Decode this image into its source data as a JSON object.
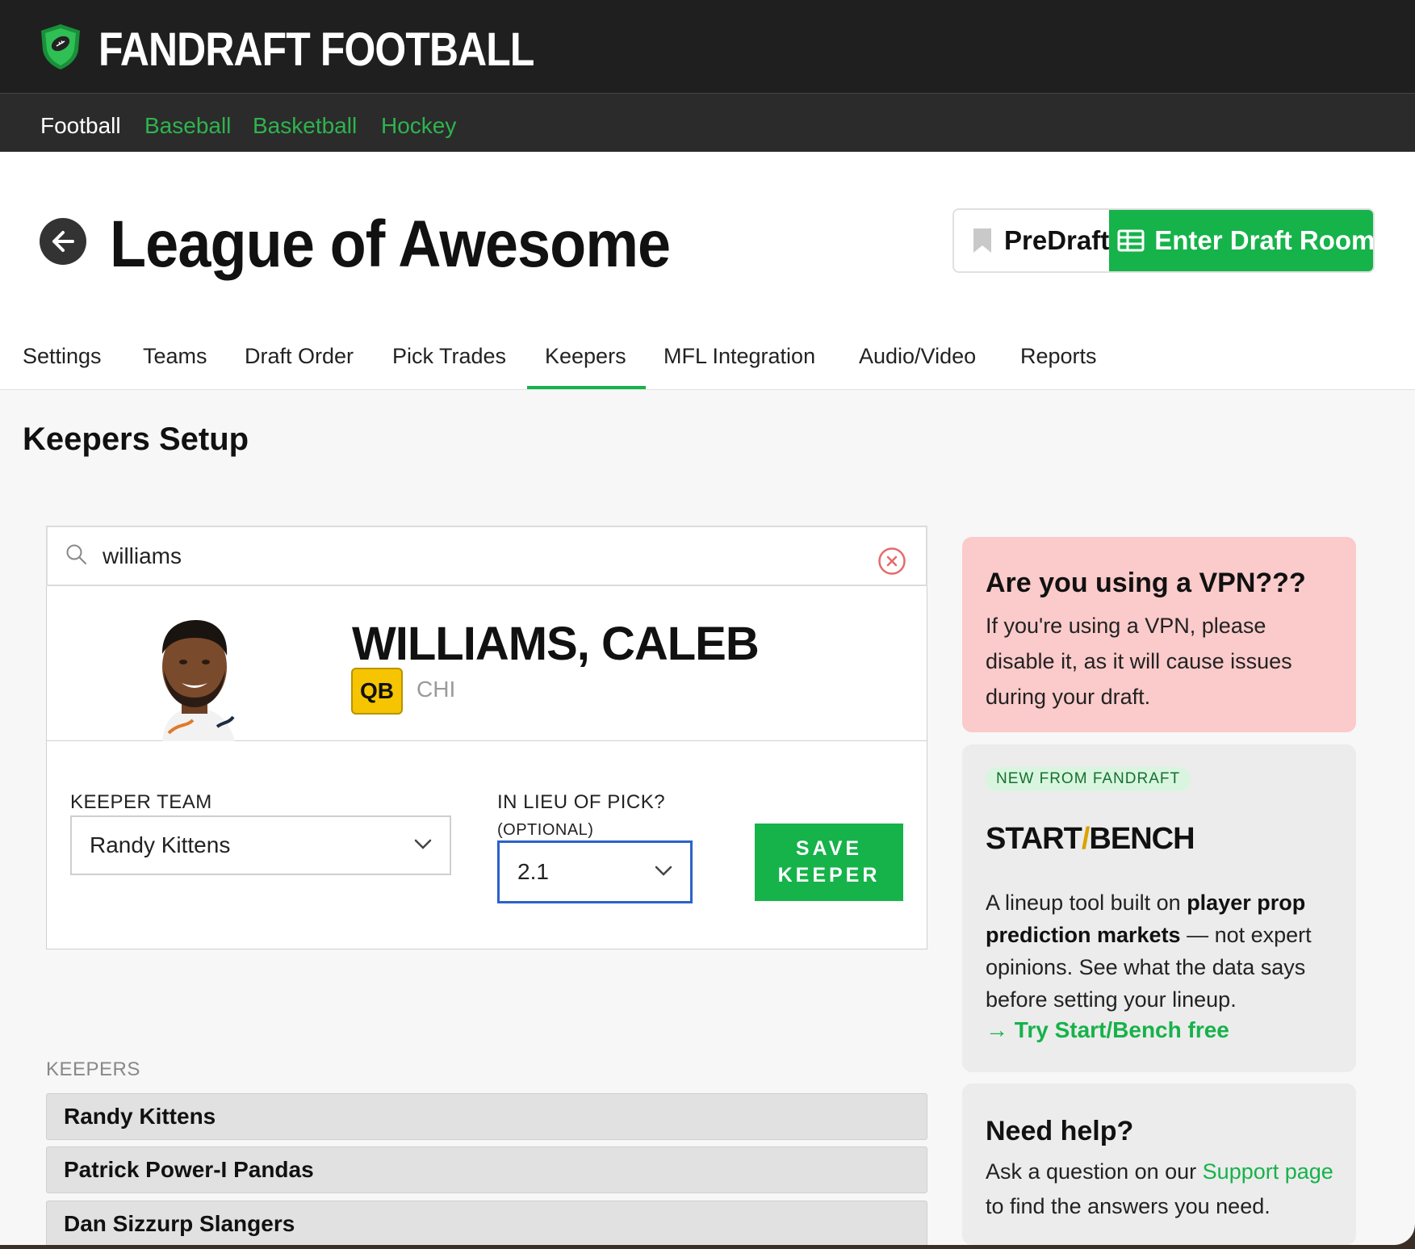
{
  "brand": {
    "name": "FANDRAFT FOOTBALL"
  },
  "sports_nav": [
    {
      "label": "Football",
      "active": true
    },
    {
      "label": "Baseball",
      "active": false
    },
    {
      "label": "Basketball",
      "active": false
    },
    {
      "label": "Hockey",
      "active": false
    }
  ],
  "header": {
    "title": "League of Awesome",
    "predraft_label": "PreDraft",
    "enter_draft_label": "Enter Draft Room"
  },
  "tabs": [
    {
      "label": "Settings",
      "active": false
    },
    {
      "label": "Teams",
      "active": false
    },
    {
      "label": "Draft Order",
      "active": false
    },
    {
      "label": "Pick Trades",
      "active": false
    },
    {
      "label": "Keepers",
      "active": true
    },
    {
      "label": "MFL Integration",
      "active": false
    },
    {
      "label": "Audio/Video",
      "active": false
    },
    {
      "label": "Reports",
      "active": false
    }
  ],
  "main": {
    "section_title": "Keepers Setup",
    "search": {
      "value": "williams"
    },
    "player": {
      "name": "WILLIAMS, CALEB",
      "position": "QB",
      "team": "CHI"
    },
    "form": {
      "keeper_team_label": "KEEPER TEAM",
      "keeper_team_value": "Randy Kittens",
      "in_lieu_label": "IN LIEU OF PICK?",
      "in_lieu_sub": "(OPTIONAL)",
      "in_lieu_value": "2.1",
      "save_label": "SAVE KEEPER"
    },
    "keepers_label": "KEEPERS",
    "keepers": [
      "Randy Kittens",
      "Patrick Power-I Pandas",
      "Dan Sizzurp Slangers"
    ]
  },
  "sidebar": {
    "vpn": {
      "title": "Are you using a VPN???",
      "text": "If you're using a VPN, please disable it, as it will cause issues during your draft."
    },
    "startbench": {
      "badge": "NEW FROM FANDRAFT",
      "logo_start": "START",
      "logo_slash": "/",
      "logo_bench": "BENCH",
      "text_1": "A lineup tool built on ",
      "text_bold": "player prop prediction markets",
      "text_2": " — not expert opinions. See what the data says before setting your lineup.",
      "link": "→ Try Start/Bench free"
    },
    "help": {
      "title": "Need help?",
      "text_1": "Ask a question on our ",
      "link": "Support page",
      "text_2": " to find the answers you need."
    }
  },
  "colors": {
    "accent": "#16b24a",
    "badge": "#f6c400",
    "vpn_bg": "#fbcaca",
    "topbar": "#1f1f1f"
  }
}
